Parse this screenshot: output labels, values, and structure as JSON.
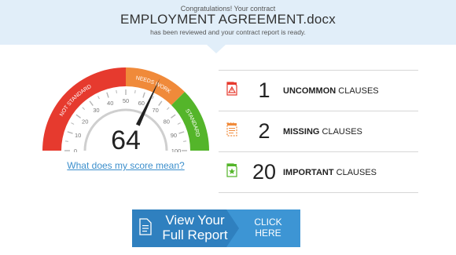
{
  "header": {
    "congrats": "Congratulations! Your contract",
    "filename": "EMPLOYMENT AGREEMENT.docx",
    "status": "has been reviewed and your contract report is ready."
  },
  "gauge": {
    "score": "64",
    "score_value": 64,
    "segments": [
      {
        "label": "NOT STANDARD",
        "color": "#e63a2e",
        "from": 0,
        "to": 50
      },
      {
        "label": "NEEDS WORK",
        "color": "#f08a3a",
        "from": 50,
        "to": 75
      },
      {
        "label": "STANDARD",
        "color": "#54b52a",
        "from": 75,
        "to": 100
      }
    ],
    "ticks": [
      "0",
      "10",
      "20",
      "30",
      "40",
      "50",
      "60",
      "70",
      "80",
      "90",
      "100"
    ],
    "help_link": "What does my score mean?"
  },
  "stats": [
    {
      "count": "1",
      "label_bold": "UNCOMMON",
      "label_rest": " CLAUSES",
      "icon": "warning-doc-icon",
      "color": "#e63a2e"
    },
    {
      "count": "2",
      "label_bold": "MISSING",
      "label_rest": " CLAUSES",
      "icon": "missing-doc-icon",
      "color": "#f08a3a"
    },
    {
      "count": "20",
      "label_bold": "IMPORTANT",
      "label_rest": " CLAUSES",
      "icon": "star-doc-icon",
      "color": "#54b52a"
    }
  ],
  "cta": {
    "title_line1": "View Your",
    "title_line2": "Full Report",
    "click_line1": "CLICK",
    "click_line2": "HERE"
  }
}
